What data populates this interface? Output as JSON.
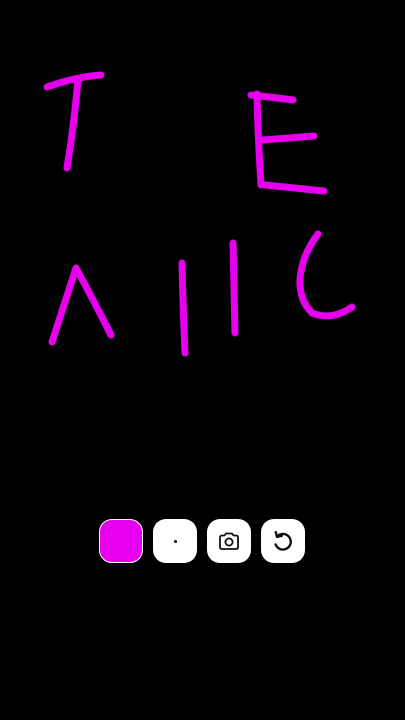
{
  "canvas": {
    "background": "#000000",
    "stroke_color": "#e600ee"
  },
  "toolbar": {
    "color_swatch": {
      "color": "#e600ee",
      "icon": "color-swatch"
    },
    "brush_size": {
      "icon": "dot-icon"
    },
    "screenshot": {
      "icon": "camera-icon"
    },
    "reset": {
      "icon": "rotate-ccw-icon"
    }
  }
}
